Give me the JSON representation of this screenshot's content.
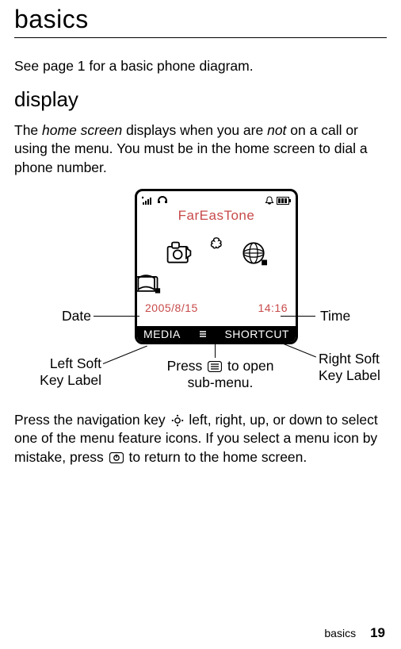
{
  "header": {
    "title": "basics"
  },
  "intro": "See page 1 for a basic phone diagram.",
  "section": {
    "title": "display"
  },
  "para1_pre": "The ",
  "para1_em1": "home screen",
  "para1_mid": " displays when you are ",
  "para1_em2": "not",
  "para1_post": " on a call or using the menu. You must be in the home screen to dial a phone number.",
  "phone": {
    "carrier": "FarEasTone",
    "date": "2005/8/15",
    "time": "14:16",
    "soft_left": "MEDIA",
    "soft_right": "SHORTCUT"
  },
  "annotations": {
    "date": "Date",
    "time": "Time",
    "left_soft1": "Left Soft",
    "left_soft2": "Key Label",
    "right_soft1": "Right Soft",
    "right_soft2": "Key Label",
    "press_pre": "Press ",
    "press_post": " to open",
    "press_line2": "sub-menu."
  },
  "para2_pre": "Press the navigation key ",
  "para2_mid": " left, right, up, or down to select one of the menu feature icons. If you select a menu icon by mistake, press ",
  "para2_post": " to return to the home screen.",
  "footer": {
    "section": "basics",
    "page": "19"
  }
}
